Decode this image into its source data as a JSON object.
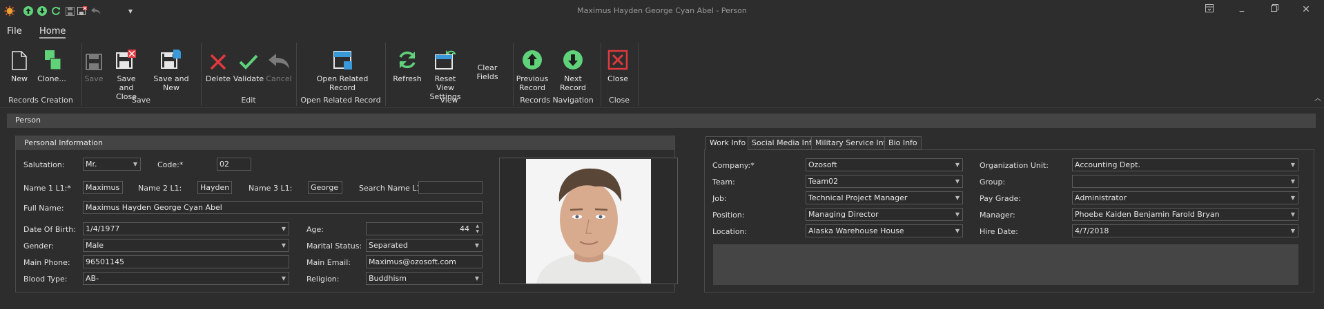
{
  "window": {
    "title": "Maximus Hayden George Cyan Abel - Person"
  },
  "quick_access": [
    "app-logo-icon",
    "arrow-up-icon",
    "arrow-down-icon",
    "refresh-icon",
    "save-icon",
    "save-close-icon",
    "undo-icon",
    "dropdown-icon"
  ],
  "menu": {
    "file": "File",
    "home": "Home"
  },
  "ribbon": {
    "buttons": {
      "new": "New",
      "clone": "Clone...",
      "save": "Save",
      "save_close": "Save and Close",
      "save_new": "Save and New",
      "delete": "Delete",
      "validate": "Validate",
      "cancel": "Cancel",
      "open_related": "Open Related Record",
      "refresh": "Refresh",
      "reset_view": "Reset View Settings",
      "clear_fields": "Clear Fields",
      "previous": "Previous Record",
      "next": "Next Record",
      "close": "Close"
    },
    "groups": {
      "records_creation": "Records Creation",
      "save": "Save",
      "edit": "Edit",
      "open_related": "Open Related Record",
      "view": "View",
      "records_navigation": "Records Navigation",
      "close": "Close"
    }
  },
  "section": {
    "title": "Person"
  },
  "personal": {
    "title": "Personal Information",
    "salutation_label": "Salutation:",
    "salutation": "Mr.",
    "code_label": "Code:*",
    "code": "02",
    "name1_label": "Name 1 L1:*",
    "name1": "Maximus",
    "name2_label": "Name 2 L1:",
    "name2": "Hayden",
    "name3_label": "Name 3 L1:",
    "name3": "George",
    "search_label": "Search Name L1:",
    "search": "",
    "fullname_label": "Full Name:",
    "fullname": "Maximus Hayden George Cyan Abel",
    "dob_label": "Date Of Birth:",
    "dob": "1/4/1977",
    "age_label": "Age:",
    "age": "44",
    "gender_label": "Gender:",
    "gender": "Male",
    "marital_label": "Marital Status:",
    "marital": "Separated",
    "phone_label": "Main Phone:",
    "phone": "96501145",
    "email_label": "Main Email:",
    "email": "Maximus@ozosoft.com",
    "blood_label": "Blood Type:",
    "blood": "AB-",
    "religion_label": "Religion:",
    "religion": "Buddhism"
  },
  "tabs": [
    "Work Info",
    "Social Media Info",
    "Military Service Info",
    "Bio Info"
  ],
  "work": {
    "company_label": "Company:*",
    "company": "Ozosoft",
    "team_label": "Team:",
    "team": "Team02",
    "job_label": "Job:",
    "job": "Technical Project Manager",
    "position_label": "Position:",
    "position": "Managing Director",
    "location_label": "Location:",
    "location": "Alaska Warehouse House",
    "org_label": "Organization Unit:",
    "org": "Accounting Dept.",
    "group_label": "Group:",
    "group": "",
    "paygrade_label": "Pay Grade:",
    "paygrade": "Administrator",
    "manager_label": "Manager:",
    "manager": "Phoebe Kaiden Benjamin Farold Bryan",
    "hire_label": "Hire Date:",
    "hire": "4/7/2018"
  },
  "colors": {
    "accent_green": "#5fd27a",
    "close_red": "#e0393e",
    "blue": "#3a9ad9"
  }
}
